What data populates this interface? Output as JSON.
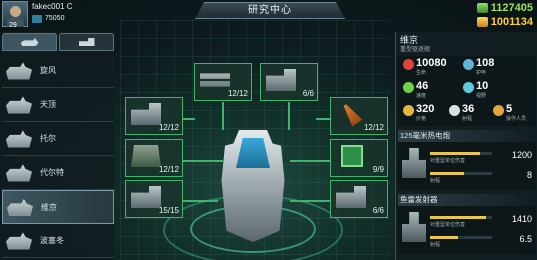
{
  "header": {
    "player_name": "fakec001 C",
    "level": "29",
    "xp": "75050",
    "title": "研究中心",
    "resource1": "1127405",
    "resource2": "1001134"
  },
  "left_tabs": [
    {
      "icon": "ship-icon"
    },
    {
      "icon": "cargo-icon"
    }
  ],
  "ships": [
    {
      "name": "旋风"
    },
    {
      "name": "天顶"
    },
    {
      "name": "托尔"
    },
    {
      "name": "代尔特"
    },
    {
      "name": "维京"
    },
    {
      "name": "波塞冬"
    }
  ],
  "selected_ship": "维京",
  "nodes": [
    {
      "count": "12/12",
      "icon": "shells-icon"
    },
    {
      "count": "6/6",
      "icon": "cannon-icon"
    },
    {
      "count": "12/12",
      "icon": "cannon-icon"
    },
    {
      "count": "12/12",
      "icon": "armor-icon"
    },
    {
      "count": "15/15",
      "icon": "cannon-icon"
    },
    {
      "count": "12/12",
      "icon": "missile-icon"
    },
    {
      "count": "9/9",
      "icon": "chip-icon"
    },
    {
      "count": "6/6",
      "icon": "cannon-icon"
    }
  ],
  "panel": {
    "name": "维京",
    "class": "重型驱逐舰",
    "stats": [
      {
        "value": "10080",
        "label": "生命",
        "color": "#e2433a"
      },
      {
        "value": "108",
        "label": "护甲",
        "color": "#5fb3d6"
      },
      {
        "value": "46",
        "label": "速度",
        "color": "#6fd24a"
      },
      {
        "value": "10",
        "label": "视野",
        "color": "#5fc8e0"
      },
      {
        "value": "320",
        "label": "价格",
        "color": "#e5b63a"
      },
      {
        "value": "36",
        "label": "射程",
        "color": "#d9dfe2"
      },
      {
        "value": "5",
        "label": "操作人员",
        "color": "#e2a63a"
      }
    ],
    "weapons": [
      {
        "title": "125毫米热电炮",
        "lines": [
          {
            "label": "对重型单位伤害",
            "value": "1200",
            "fill": 0.8
          },
          {
            "label": "射程",
            "value": "8",
            "fill": 0.55
          }
        ]
      },
      {
        "title": "鱼雷发射器",
        "lines": [
          {
            "label": "对重型单位伤害",
            "value": "1410",
            "fill": 0.9
          },
          {
            "label": "射程",
            "value": "6.5",
            "fill": 0.45
          }
        ]
      }
    ]
  },
  "colors": {
    "accent_green": "#3fb56b",
    "resource1": "#9be35a",
    "resource2": "#ffcf3a",
    "bar_fill": "#e7c64a"
  }
}
